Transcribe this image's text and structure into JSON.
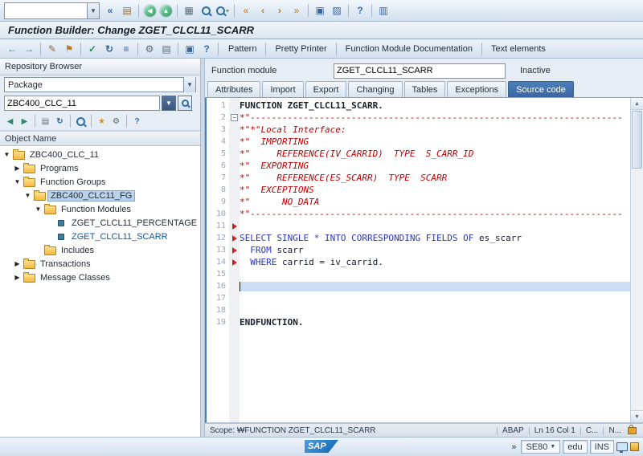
{
  "title_bar": {
    "title": "Function Builder: Change ZGET_CLCL11_SCARR"
  },
  "system_toolbar": {
    "command_value": "",
    "icons": [
      {
        "name": "enter-icon",
        "glyph": "«",
        "fg": "#2f6fb2",
        "bold": true
      },
      {
        "name": "save-icon",
        "glyph": "▤",
        "fg": "#8a6d3b"
      },
      {
        "sep": true
      },
      {
        "name": "back-icon",
        "glyph": "◀",
        "shape": "circle",
        "fg": "#ffffff",
        "bg": "radial-gradient(circle at 35% 30%, #7fd4a8, #2f9560)"
      },
      {
        "name": "exit-icon",
        "glyph": "▲",
        "shape": "circle",
        "fg": "#ffffff",
        "bg": "radial-gradient(circle at 35% 30%, #7fd4a8, #2f9560)"
      },
      {
        "sep": true
      },
      {
        "name": "print-icon",
        "glyph": "▦",
        "fg": "#5a6b7a"
      },
      {
        "name": "find-icon",
        "kind": "mag"
      },
      {
        "name": "find-next-icon",
        "kind": "mag",
        "plus": true
      },
      {
        "sep": true
      },
      {
        "name": "first-page-icon",
        "glyph": "«",
        "fg": "#b07a23"
      },
      {
        "name": "previous-page-icon",
        "glyph": "‹",
        "fg": "#b07a23",
        "bold": true
      },
      {
        "name": "next-page-icon",
        "glyph": "›",
        "fg": "#b07a23",
        "bold": true
      },
      {
        "name": "last-page-icon",
        "glyph": "»",
        "fg": "#b07a23"
      },
      {
        "sep": true
      },
      {
        "name": "new-session-icon",
        "glyph": "▣",
        "fg": "#35649e"
      },
      {
        "name": "create-shortcut-icon",
        "glyph": "▨",
        "fg": "#35649e"
      },
      {
        "sep": true
      },
      {
        "name": "help-icon",
        "glyph": "?",
        "fg": "#2f6fb2",
        "bold": true
      },
      {
        "sep": true
      },
      {
        "name": "customize-layout-icon",
        "glyph": "▥",
        "fg": "#35649e"
      }
    ]
  },
  "app_toolbar": {
    "icons": [
      {
        "name": "back-arrow-icon",
        "glyph": "←",
        "fg": "#2d8a70",
        "bold": true
      },
      {
        "name": "forward-arrow-icon",
        "glyph": "→",
        "fg": "#2d8a70",
        "bold": true
      },
      {
        "sep": true
      },
      {
        "name": "display-change-icon",
        "glyph": "✎",
        "fg": "#8a6d3b"
      },
      {
        "name": "activate-icon",
        "glyph": "⚑",
        "fg": "#bf7b2a"
      },
      {
        "sep": true
      },
      {
        "name": "syntax-check-icon",
        "glyph": "✓",
        "fg": "#2e8b57",
        "bold": true
      },
      {
        "name": "where-used-icon",
        "glyph": "↻",
        "fg": "#35649e",
        "bold": true
      },
      {
        "name": "object-list-icon",
        "glyph": "≡",
        "fg": "#35649e",
        "bold": true
      },
      {
        "sep": true
      },
      {
        "name": "test-icon",
        "glyph": "⚙",
        "fg": "#5a6b7a"
      },
      {
        "name": "copy-icon",
        "glyph": "▤",
        "fg": "#5a6b7a"
      },
      {
        "sep": true
      },
      {
        "name": "goto-icon",
        "glyph": "▣",
        "fg": "#35649e"
      },
      {
        "name": "info-icon",
        "glyph": "?",
        "fg": "#2f6fb2",
        "bold": true
      },
      {
        "sep": true
      }
    ],
    "buttons": [
      "Pattern",
      "Pretty Printer",
      "Function Module Documentation",
      "Text elements"
    ]
  },
  "sidebar": {
    "header": "Repository Browser",
    "browser_type": "Package",
    "object_value": "ZBC400_CLC_11",
    "toolbar_icons": [
      {
        "name": "back-icon",
        "glyph": "◀",
        "fg": "#2d8a70"
      },
      {
        "name": "forward-icon",
        "glyph": "▶",
        "fg": "#2d8a70"
      },
      {
        "sep": true
      },
      {
        "name": "hide-browser-icon",
        "glyph": "▤",
        "fg": "#5a6b7a"
      },
      {
        "name": "refresh-icon",
        "glyph": "↻",
        "fg": "#35649e",
        "bold": true
      },
      {
        "sep": true
      },
      {
        "name": "find-icon",
        "kind": "mag"
      },
      {
        "sep": true
      },
      {
        "name": "favorites-icon",
        "glyph": "★",
        "fg": "#c9922a"
      },
      {
        "name": "settings-icon",
        "glyph": "⚙",
        "fg": "#5a6b7a"
      },
      {
        "sep": true
      },
      {
        "name": "help-icon",
        "glyph": "?",
        "fg": "#2f6fb2",
        "bold": true
      }
    ],
    "column_header": "Object Name",
    "tree": [
      {
        "label": "ZBC400_CLC_11",
        "level": 0,
        "icon": "folder",
        "expander": "expanded"
      },
      {
        "label": "Programs",
        "level": 1,
        "icon": "folder",
        "expander": "collapsed"
      },
      {
        "label": "Function Groups",
        "level": 1,
        "icon": "folder",
        "expander": "expanded"
      },
      {
        "label": "ZBC400_CLC11_FG",
        "level": 2,
        "icon": "folder",
        "expander": "expanded",
        "selected": true
      },
      {
        "label": "Function Modules",
        "level": 3,
        "icon": "folder",
        "expander": "expanded"
      },
      {
        "label": "ZGET_CLCL11_PERCENTAGE",
        "level": 4,
        "icon": "leaf"
      },
      {
        "label": "ZGET_CLCL11_SCARR",
        "level": 4,
        "icon": "leaf",
        "active": true
      },
      {
        "label": "Includes",
        "level": 3,
        "icon": "folder",
        "expander": "none"
      },
      {
        "label": "Transactions",
        "level": 1,
        "icon": "folder",
        "expander": "collapsed"
      },
      {
        "label": "Message Classes",
        "level": 1,
        "icon": "folder",
        "expander": "collapsed"
      }
    ]
  },
  "main": {
    "function_module_label": "Function module",
    "function_module_value": "ZGET_CLCL11_SCARR",
    "status_text": "Inactive",
    "tabs": [
      {
        "label": "Attributes"
      },
      {
        "label": "Import"
      },
      {
        "label": "Export"
      },
      {
        "label": "Changing"
      },
      {
        "label": "Tables"
      },
      {
        "label": "Exceptions"
      },
      {
        "label": "Source code",
        "active": true
      }
    ],
    "editor": {
      "lines": [
        {
          "n": 1,
          "segments": [
            {
              "t": "FUNCTION ZGET_CLCL11_SCARR.",
              "c": "b"
            }
          ]
        },
        {
          "n": 2,
          "fold": true,
          "segments": [
            {
              "t": "*\"----------------------------------------------------------------------",
              "c": "c"
            }
          ]
        },
        {
          "n": 3,
          "segments": [
            {
              "t": "*\"*\"Local Interface:",
              "c": "c"
            }
          ]
        },
        {
          "n": 4,
          "segments": [
            {
              "t": "*\"  IMPORTING",
              "c": "c"
            }
          ]
        },
        {
          "n": 5,
          "segments": [
            {
              "t": "*\"     REFERENCE(IV_CARRID)  TYPE  S_CARR_ID",
              "c": "c"
            }
          ]
        },
        {
          "n": 6,
          "segments": [
            {
              "t": "*\"  EXPORTING",
              "c": "c"
            }
          ]
        },
        {
          "n": 7,
          "segments": [
            {
              "t": "*\"     REFERENCE(ES_SCARR)  TYPE  SCARR",
              "c": "c"
            }
          ]
        },
        {
          "n": 8,
          "segments": [
            {
              "t": "*\"  EXCEPTIONS",
              "c": "c"
            }
          ]
        },
        {
          "n": 9,
          "segments": [
            {
              "t": "*\"      NO_DATA",
              "c": "c"
            }
          ]
        },
        {
          "n": 10,
          "segments": [
            {
              "t": "*\"----------------------------------------------------------------------",
              "c": "c"
            }
          ]
        },
        {
          "n": 11,
          "marker": true,
          "segments": []
        },
        {
          "n": 12,
          "marker": true,
          "segments": [
            {
              "t": "SELECT SINGLE * INTO CORRESPONDING FIELDS OF ",
              "c": "k"
            },
            {
              "t": "es_scarr",
              "c": "p"
            }
          ]
        },
        {
          "n": 13,
          "marker": true,
          "segments": [
            {
              "t": "  ",
              "c": "p"
            },
            {
              "t": "FROM",
              "c": "k"
            },
            {
              "t": " scarr",
              "c": "p"
            }
          ]
        },
        {
          "n": 14,
          "marker": true,
          "segments": [
            {
              "t": "  ",
              "c": "p"
            },
            {
              "t": "WHERE",
              "c": "k"
            },
            {
              "t": " carrid = iv_carrid.",
              "c": "p"
            }
          ]
        },
        {
          "n": 15,
          "segments": []
        },
        {
          "n": 16,
          "current": true,
          "segments": []
        },
        {
          "n": 17,
          "segments": []
        },
        {
          "n": 18,
          "segments": []
        },
        {
          "n": 19,
          "segments": [
            {
              "t": "ENDFUNCTION.",
              "c": "b"
            }
          ]
        }
      ]
    },
    "editor_status": {
      "scope": "Scope: ₩FUNCTION ZGET_CLCL11_SCARR",
      "items": [
        "ABAP",
        "Ln 16 Col 1",
        "C...",
        "N..."
      ]
    }
  },
  "status_bar": {
    "logo": "SAP",
    "expand": "»",
    "transaction": "SE80",
    "client": "edu",
    "mode": "INS"
  }
}
